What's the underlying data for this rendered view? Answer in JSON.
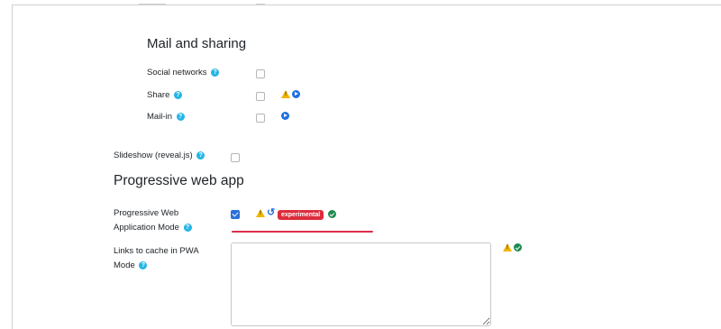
{
  "sections": {
    "mail_sharing": {
      "title": "Mail and sharing",
      "items": [
        {
          "label": "Social networks",
          "checked": false,
          "indicators": []
        },
        {
          "label": "Share",
          "checked": false,
          "indicators": [
            "warning-icon",
            "play-icon"
          ]
        },
        {
          "label": "Mail-in",
          "checked": false,
          "indicators": [
            "play-icon"
          ]
        }
      ]
    },
    "slideshow": {
      "label": "Slideshow (reveal.js)",
      "checked": false
    },
    "pwa": {
      "title": "Progressive web app",
      "mode": {
        "label_line1": "Progressive Web",
        "label_line2": "Application Mode",
        "checked": true,
        "badge": "experimental"
      },
      "links": {
        "label_line1": "Links to cache in PWA",
        "label_line2": "Mode",
        "value": ""
      }
    }
  },
  "help_glyph": "?",
  "colors": {
    "help": "#25b5e5",
    "warning": "#f0b400",
    "info": "#1f6fe0",
    "success": "#1d8a4e",
    "badge": "#dc2d3c",
    "checkbox_checked": "#2a70d8"
  }
}
